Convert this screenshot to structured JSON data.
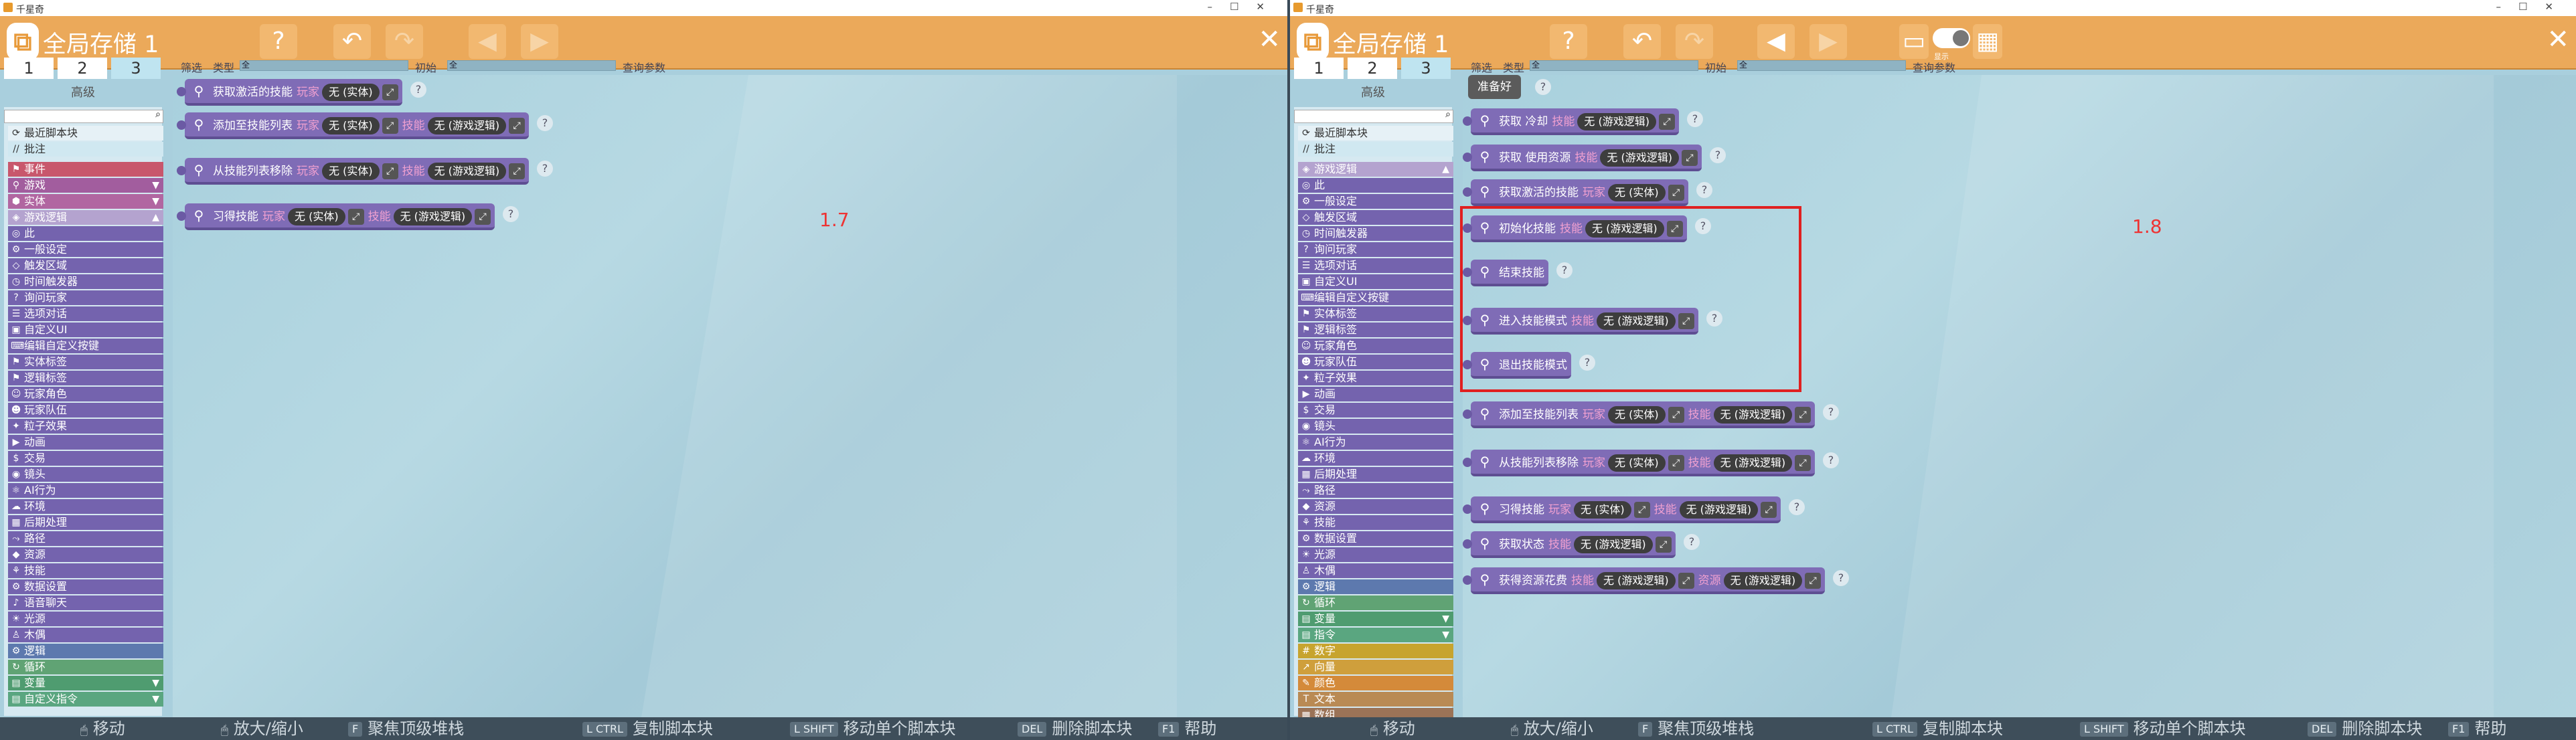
{
  "left": {
    "window_title": "千星奇",
    "store_title": "全局存储 1",
    "tabs": [
      "1",
      "2",
      "3"
    ],
    "mode_label": "高级",
    "filter": {
      "label": "筛选",
      "type_label": "类型",
      "type_value": "全",
      "init_label": "初始",
      "init_value": "全",
      "query_label": "查询参数"
    },
    "quick": [
      {
        "icon": "⟳",
        "label": "最近脚本块"
      },
      {
        "icon": "//",
        "label": "批注"
      }
    ],
    "categories": [
      {
        "label": "事件",
        "cls": "c-event",
        "icon": "⚑"
      },
      {
        "label": "游戏",
        "cls": "c-game",
        "icon": "⚲",
        "arrow": "▼"
      },
      {
        "label": "实体",
        "cls": "c-entity",
        "icon": "⬢",
        "arrow": "▼"
      },
      {
        "label": "游戏逻辑",
        "cls": "c-logic",
        "icon": "◈",
        "arrow": "▲"
      },
      {
        "label": "此",
        "cls": "c-item",
        "icon": "◎"
      },
      {
        "label": "一般设定",
        "cls": "c-item",
        "icon": "⚙"
      },
      {
        "label": "触发区域",
        "cls": "c-item",
        "icon": "◇"
      },
      {
        "label": "时间触发器",
        "cls": "c-item",
        "icon": "◷"
      },
      {
        "label": "询问玩家",
        "cls": "c-item",
        "icon": "?"
      },
      {
        "label": "选项对话",
        "cls": "c-item",
        "icon": "☰"
      },
      {
        "label": "自定义UI",
        "cls": "c-item",
        "icon": "▣"
      },
      {
        "label": "编辑自定义按键",
        "cls": "c-item",
        "icon": "⌨"
      },
      {
        "label": "实体标签",
        "cls": "c-item",
        "icon": "⚑"
      },
      {
        "label": "逻辑标签",
        "cls": "c-item",
        "icon": "⚑"
      },
      {
        "label": "玩家角色",
        "cls": "c-item",
        "icon": "☺"
      },
      {
        "label": "玩家队伍",
        "cls": "c-item",
        "icon": "☻"
      },
      {
        "label": "粒子效果",
        "cls": "c-item",
        "icon": "✦"
      },
      {
        "label": "动画",
        "cls": "c-item",
        "icon": "▶"
      },
      {
        "label": "交易",
        "cls": "c-item",
        "icon": "$"
      },
      {
        "label": "镜头",
        "cls": "c-item",
        "icon": "◉"
      },
      {
        "label": "AI行为",
        "cls": "c-item",
        "icon": "⚛"
      },
      {
        "label": "环境",
        "cls": "c-item",
        "icon": "☁"
      },
      {
        "label": "后期处理",
        "cls": "c-item",
        "icon": "▦"
      },
      {
        "label": "路径",
        "cls": "c-item",
        "icon": "⤳"
      },
      {
        "label": "资源",
        "cls": "c-item",
        "icon": "◆"
      },
      {
        "label": "技能",
        "cls": "c-item",
        "icon": "⚘"
      },
      {
        "label": "数据设置",
        "cls": "c-item",
        "icon": "⚙"
      },
      {
        "label": "语音聊天",
        "cls": "c-item",
        "icon": "♪"
      },
      {
        "label": "光源",
        "cls": "c-item",
        "icon": "☀"
      },
      {
        "label": "木偶",
        "cls": "c-item",
        "icon": "♙"
      },
      {
        "label": "逻辑",
        "cls": "c-flow",
        "icon": "⚙"
      },
      {
        "label": "循环",
        "cls": "c-loop",
        "icon": "↻"
      },
      {
        "label": "变量",
        "cls": "c-var",
        "icon": "▤",
        "arrow": "▼"
      },
      {
        "label": "自定义指令",
        "cls": "c-cmd",
        "icon": "▤",
        "arrow": "▼"
      }
    ],
    "blocks": [
      {
        "label": "获取激活的技能",
        "parts": [
          {
            "k": "hint",
            "t": "玩家"
          },
          {
            "k": "slot",
            "t": "无 (实体)"
          }
        ]
      },
      {
        "label": "添加至技能列表",
        "parts": [
          {
            "k": "hint",
            "t": "玩家"
          },
          {
            "k": "slot",
            "t": "无 (实体)"
          },
          {
            "k": "hint",
            "t": "技能"
          },
          {
            "k": "slot",
            "t": "无 (游戏逻辑)"
          }
        ]
      },
      {
        "label": "从技能列表移除",
        "parts": [
          {
            "k": "hint",
            "t": "玩家"
          },
          {
            "k": "slot",
            "t": "无 (实体)"
          },
          {
            "k": "hint",
            "t": "技能"
          },
          {
            "k": "slot",
            "t": "无 (游戏逻辑)"
          }
        ]
      },
      {
        "label": "习得技能",
        "parts": [
          {
            "k": "hint",
            "t": "玩家"
          },
          {
            "k": "slot",
            "t": "无 (实体)"
          },
          {
            "k": "hint",
            "t": "技能"
          },
          {
            "k": "slot",
            "t": "无 (游戏逻辑)"
          }
        ]
      }
    ],
    "version_label": "1.7"
  },
  "right": {
    "window_title": "千星奇",
    "store_title": "全局存储 1",
    "tabs": [
      "1",
      "2",
      "3"
    ],
    "mode_label": "高级",
    "toggle_label": "显示",
    "filter": {
      "label": "筛选",
      "type_label": "类型",
      "type_value": "全",
      "init_label": "初始",
      "init_value": "全",
      "query_label": "查询参数"
    },
    "quick": [
      {
        "icon": "⟳",
        "label": "最近脚本块"
      },
      {
        "icon": "//",
        "label": "批注"
      }
    ],
    "categories": [
      {
        "label": "游戏逻辑",
        "cls": "c-logic",
        "icon": "◈",
        "arrow": "▲"
      },
      {
        "label": "此",
        "cls": "c-item",
        "icon": "◎"
      },
      {
        "label": "一般设定",
        "cls": "c-item",
        "icon": "⚙"
      },
      {
        "label": "触发区域",
        "cls": "c-item",
        "icon": "◇"
      },
      {
        "label": "时间触发器",
        "cls": "c-item",
        "icon": "◷"
      },
      {
        "label": "询问玩家",
        "cls": "c-item",
        "icon": "?"
      },
      {
        "label": "选项对话",
        "cls": "c-item",
        "icon": "☰"
      },
      {
        "label": "自定义UI",
        "cls": "c-item",
        "icon": "▣"
      },
      {
        "label": "编辑自定义按键",
        "cls": "c-item",
        "icon": "⌨"
      },
      {
        "label": "实体标签",
        "cls": "c-item",
        "icon": "⚑"
      },
      {
        "label": "逻辑标签",
        "cls": "c-item",
        "icon": "⚑"
      },
      {
        "label": "玩家角色",
        "cls": "c-item",
        "icon": "☺"
      },
      {
        "label": "玩家队伍",
        "cls": "c-item",
        "icon": "☻"
      },
      {
        "label": "粒子效果",
        "cls": "c-item",
        "icon": "✦"
      },
      {
        "label": "动画",
        "cls": "c-item",
        "icon": "▶"
      },
      {
        "label": "交易",
        "cls": "c-item",
        "icon": "$"
      },
      {
        "label": "镜头",
        "cls": "c-item",
        "icon": "◉"
      },
      {
        "label": "AI行为",
        "cls": "c-item",
        "icon": "⚛"
      },
      {
        "label": "环境",
        "cls": "c-item",
        "icon": "☁"
      },
      {
        "label": "后期处理",
        "cls": "c-item",
        "icon": "▦"
      },
      {
        "label": "路径",
        "cls": "c-item",
        "icon": "⤳"
      },
      {
        "label": "资源",
        "cls": "c-item",
        "icon": "◆"
      },
      {
        "label": "技能",
        "cls": "c-item",
        "icon": "⚘"
      },
      {
        "label": "数据设置",
        "cls": "c-item",
        "icon": "⚙"
      },
      {
        "label": "光源",
        "cls": "c-item",
        "icon": "☀"
      },
      {
        "label": "木偶",
        "cls": "c-item",
        "icon": "♙"
      },
      {
        "label": "逻辑",
        "cls": "c-flow",
        "icon": "⚙"
      },
      {
        "label": "循环",
        "cls": "c-loop",
        "icon": "↻"
      },
      {
        "label": "变量",
        "cls": "c-var",
        "icon": "▤",
        "arrow": "▼"
      },
      {
        "label": "指令",
        "cls": "c-cmd",
        "icon": "▤",
        "arrow": "▼"
      },
      {
        "label": "数字",
        "cls": "c-num",
        "icon": "#"
      },
      {
        "label": "向量",
        "cls": "c-vec",
        "icon": "↗"
      },
      {
        "label": "颜色",
        "cls": "c-color",
        "icon": "✎"
      },
      {
        "label": "文本",
        "cls": "c-text",
        "icon": "T"
      },
      {
        "label": "数组",
        "cls": "c-data",
        "icon": "▦"
      }
    ],
    "ready_label": "准备好",
    "blocks": [
      {
        "label": "获取 冷却",
        "parts": [
          {
            "k": "hint",
            "t": "技能"
          },
          {
            "k": "slot",
            "t": "无 (游戏逻辑)"
          }
        ]
      },
      {
        "label": "获取 使用资源",
        "parts": [
          {
            "k": "hint",
            "t": "技能"
          },
          {
            "k": "slot",
            "t": "无 (游戏逻辑)"
          }
        ]
      },
      {
        "label": "获取激活的技能",
        "parts": [
          {
            "k": "hint",
            "t": "玩家"
          },
          {
            "k": "slot",
            "t": "无 (实体)"
          }
        ]
      },
      {
        "label": "初始化技能",
        "parts": [
          {
            "k": "hint",
            "t": "技能"
          },
          {
            "k": "slot",
            "t": "无 (游戏逻辑)"
          }
        ]
      },
      {
        "label": "结束技能",
        "parts": []
      },
      {
        "label": "进入技能模式",
        "parts": [
          {
            "k": "hint",
            "t": "技能"
          },
          {
            "k": "slot",
            "t": "无 (游戏逻辑)"
          }
        ]
      },
      {
        "label": "退出技能模式",
        "parts": []
      },
      {
        "label": "添加至技能列表",
        "parts": [
          {
            "k": "hint",
            "t": "玩家"
          },
          {
            "k": "slot",
            "t": "无 (实体)"
          },
          {
            "k": "hint",
            "t": "技能"
          },
          {
            "k": "slot",
            "t": "无 (游戏逻辑)"
          }
        ]
      },
      {
        "label": "从技能列表移除",
        "parts": [
          {
            "k": "hint",
            "t": "玩家"
          },
          {
            "k": "slot",
            "t": "无 (实体)"
          },
          {
            "k": "hint",
            "t": "技能"
          },
          {
            "k": "slot",
            "t": "无 (游戏逻辑)"
          }
        ]
      },
      {
        "label": "习得技能",
        "parts": [
          {
            "k": "hint",
            "t": "玩家"
          },
          {
            "k": "slot",
            "t": "无 (实体)"
          },
          {
            "k": "hint",
            "t": "技能"
          },
          {
            "k": "slot",
            "t": "无 (游戏逻辑)"
          }
        ]
      },
      {
        "label": "获取状态",
        "parts": [
          {
            "k": "hint",
            "t": "技能"
          },
          {
            "k": "slot",
            "t": "无 (游戏逻辑)"
          }
        ]
      },
      {
        "label": "获得资源花费",
        "parts": [
          {
            "k": "hint",
            "t": "技能"
          },
          {
            "k": "slot",
            "t": "无 (游戏逻辑)"
          },
          {
            "k": "hint",
            "t": "资源"
          },
          {
            "k": "slot",
            "t": "无 (游戏逻辑)"
          }
        ]
      }
    ],
    "version_label": "1.8"
  },
  "status": [
    {
      "key": "",
      "label": "移动"
    },
    {
      "key": "",
      "label": "放大/缩小"
    },
    {
      "key": "F",
      "label": "聚焦顶级堆栈"
    },
    {
      "key": "L CTRL",
      "label": "复制脚本块"
    },
    {
      "key": "L SHIFT",
      "label": "移动单个脚本块"
    },
    {
      "key": "DEL",
      "label": "删除脚本块"
    },
    {
      "key": "F1",
      "label": "帮助"
    }
  ],
  "colors": {
    "toolbar": "#eba95a",
    "block": "#7f6cb6",
    "highlight": "#e02020",
    "accent_label": "#e33333"
  }
}
